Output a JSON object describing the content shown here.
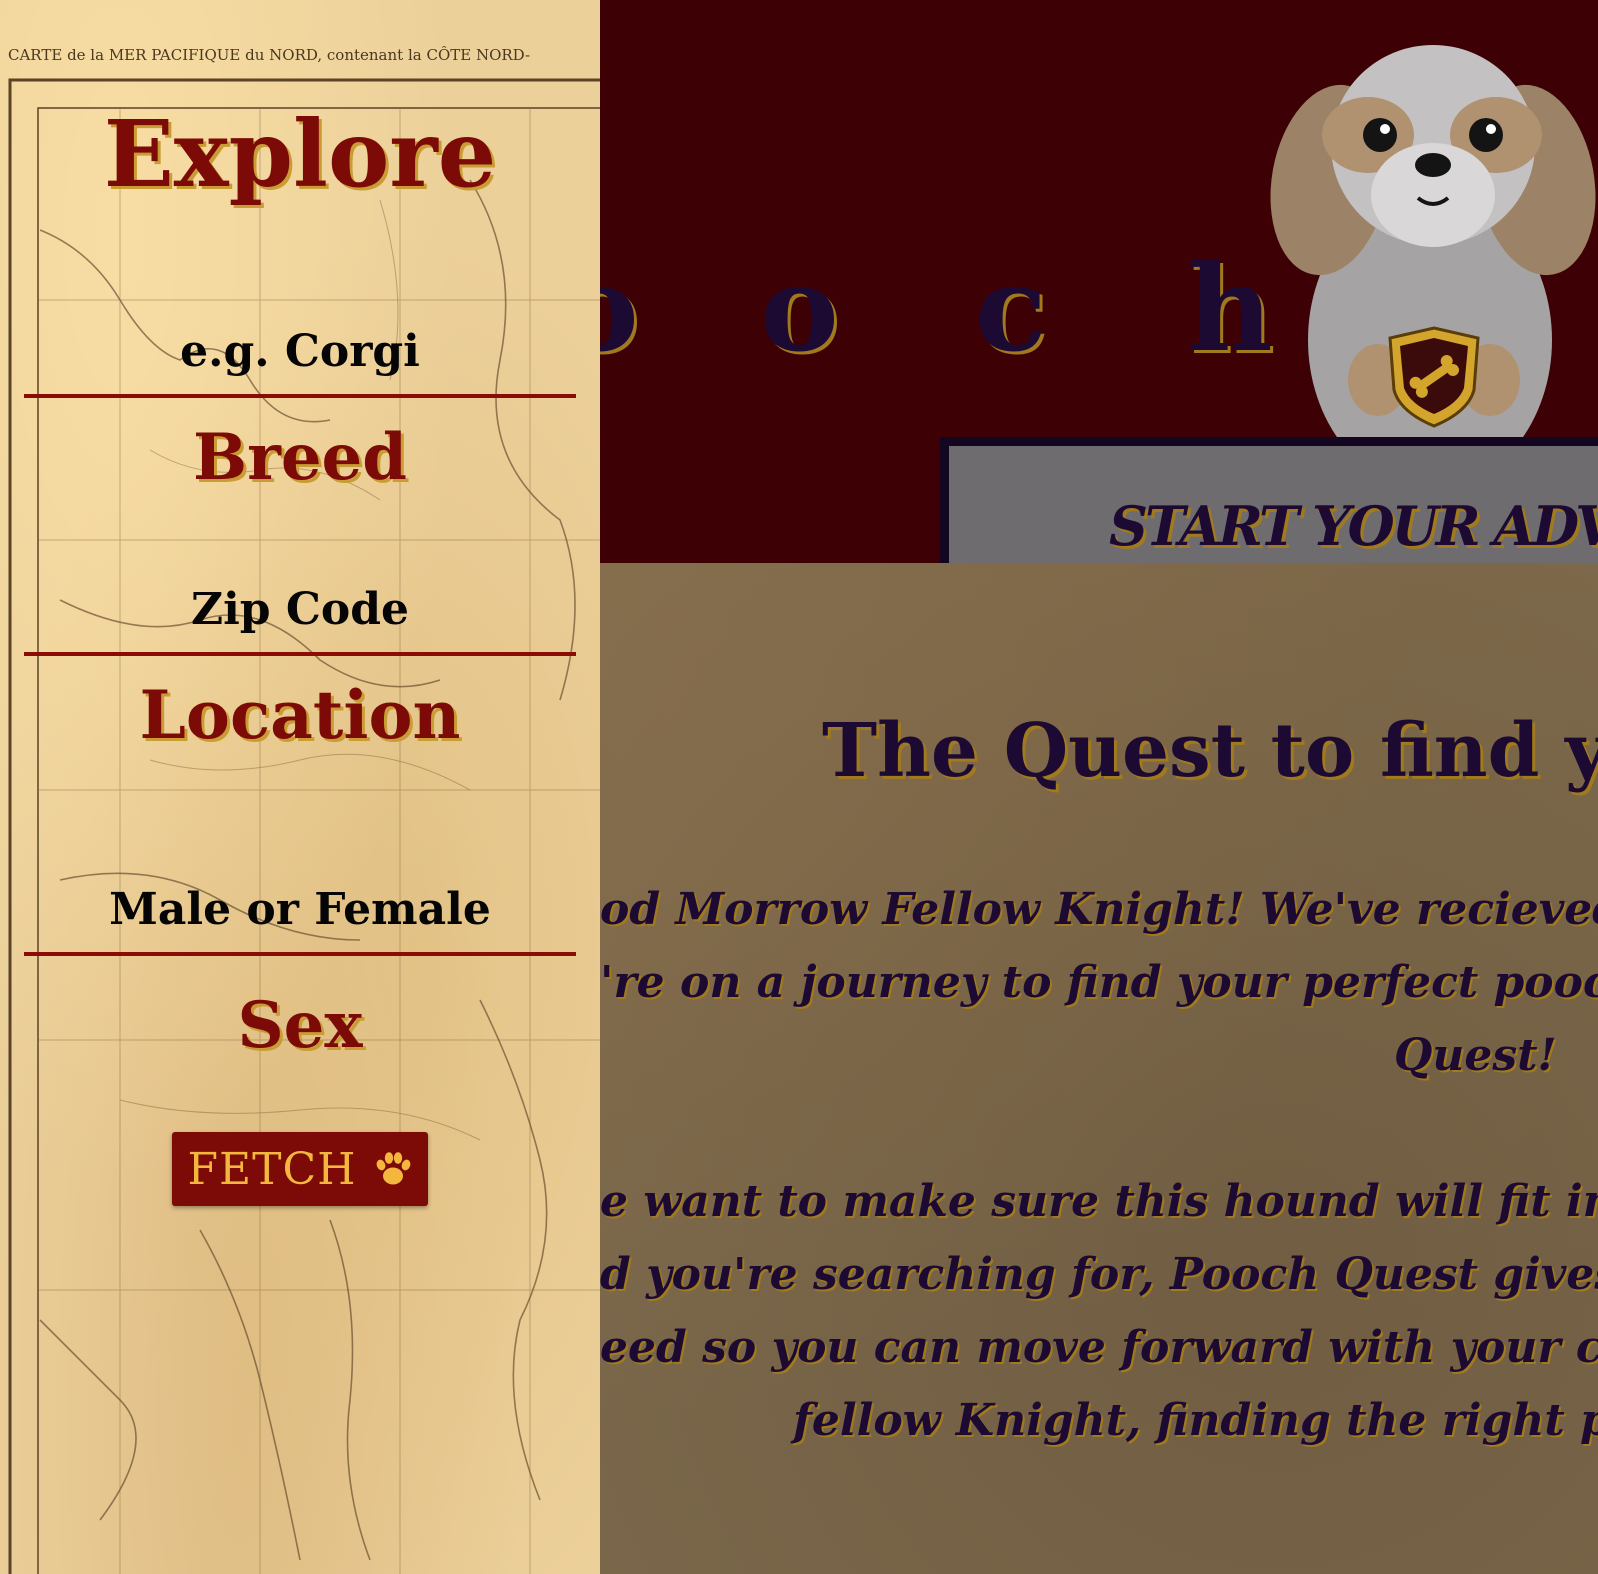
{
  "hero": {
    "visible_letters": [
      "o",
      "o",
      "c",
      "h"
    ],
    "adventure_label": "START YOUR ADVEN"
  },
  "content": {
    "title": "The Quest to find your T",
    "paragraph1_lines": [
      "od Morrow Fellow Knight! We've recieved a rav",
      "'re on a journey to find your perfect pooch! You",
      "Quest!"
    ],
    "paragraph2_lines": [
      "e want to make sure this hound will fit into your",
      "d you're searching for, Pooch Quest gives you pe",
      "eed so you can move forward with your choice b",
      "fellow Knight, finding the right pooch"
    ]
  },
  "sidebar": {
    "title": "Explore",
    "breed": {
      "label": "Breed",
      "placeholder": "e.g. Corgi"
    },
    "location": {
      "label": "Location",
      "placeholder": "Zip Code"
    },
    "sex": {
      "label": "Sex",
      "placeholder": "Male or Female"
    },
    "fetch_label": "FETCH",
    "fetch_icon": "paw-icon",
    "map_caption": "CARTE de la MER PACIFIQUE du NORD, contenant la CÔTE NORD-"
  },
  "colors": {
    "hero_bg": "#3d0004",
    "accent_red": "#7c0a06",
    "gold": "#f2b73c",
    "ink": "#1c0a33"
  }
}
